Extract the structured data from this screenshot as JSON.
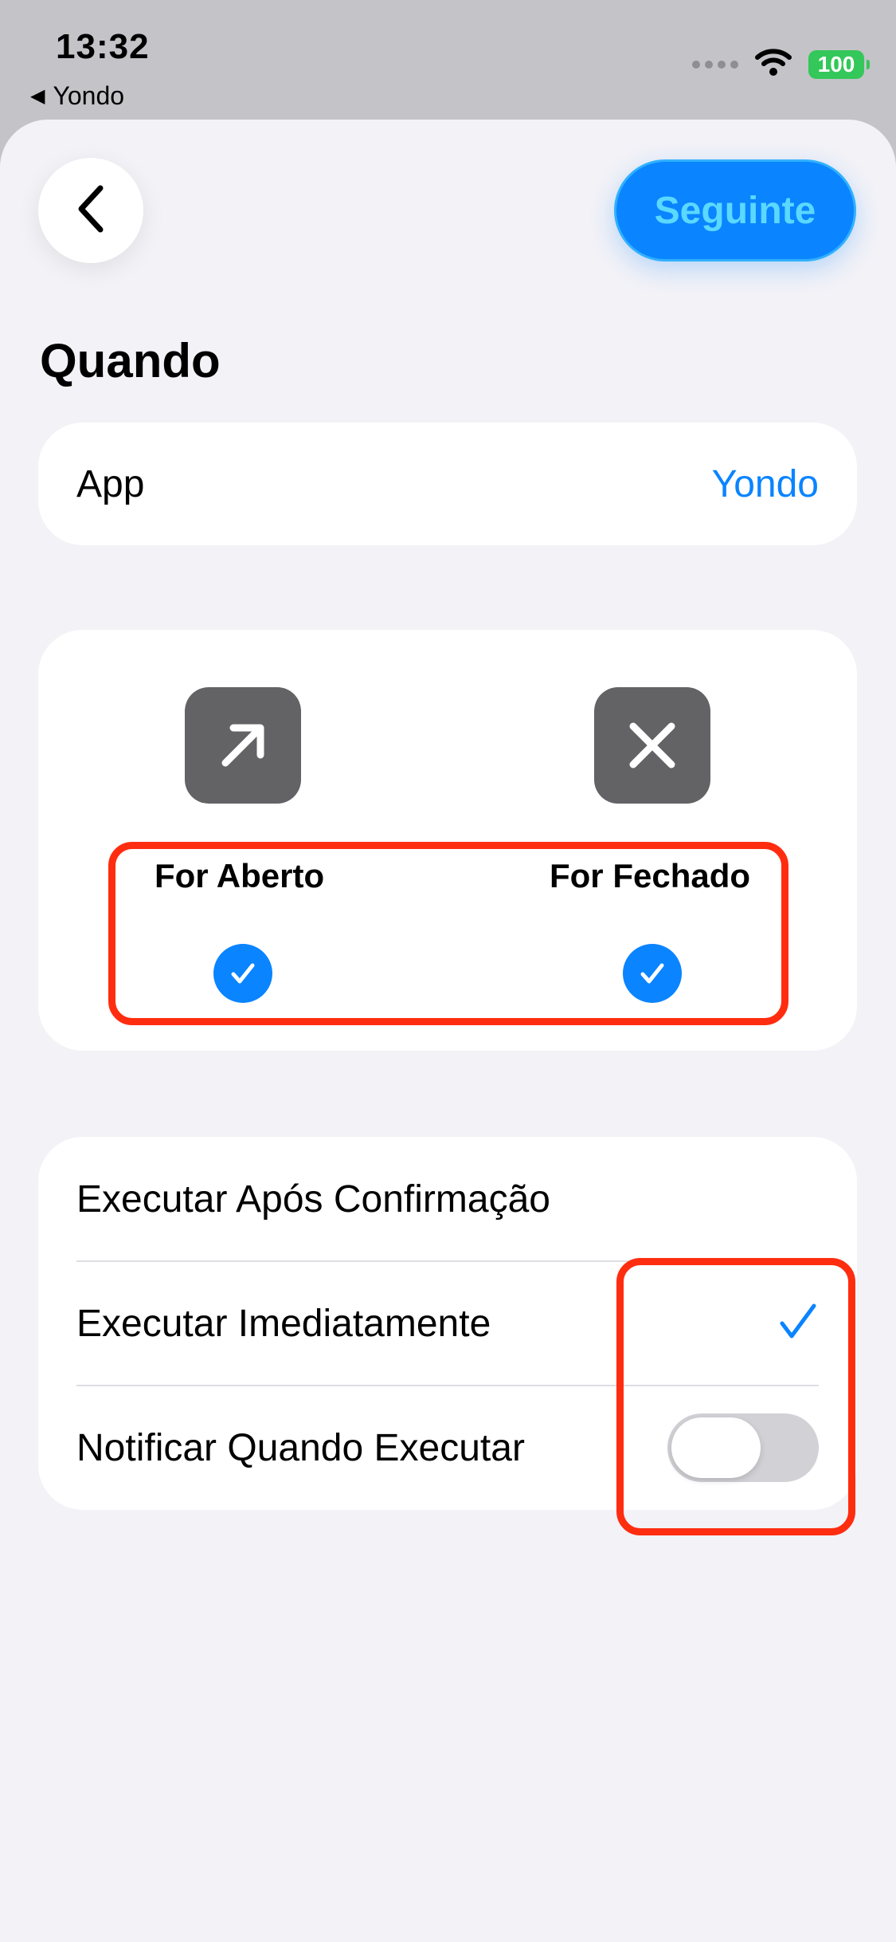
{
  "status_bar": {
    "time": "13:32",
    "back_app": "Yondo",
    "battery": "100"
  },
  "header": {
    "next_label": "Seguinte"
  },
  "section_title": "Quando",
  "app_row": {
    "label": "App",
    "value": "Yondo"
  },
  "events": [
    {
      "label": "For Aberto",
      "icon": "arrow-up-right-icon",
      "checked": true
    },
    {
      "label": "For Fechado",
      "icon": "close-icon",
      "checked": true
    }
  ],
  "options": {
    "after_confirmation": "Executar Após Confirmação",
    "immediately": "Executar Imediatamente",
    "immediately_selected": true,
    "notify": "Notificar Quando Executar",
    "notify_enabled": false
  },
  "colors": {
    "accent": "#0a84ff",
    "highlight": "#ff2d10",
    "battery": "#34c759"
  }
}
